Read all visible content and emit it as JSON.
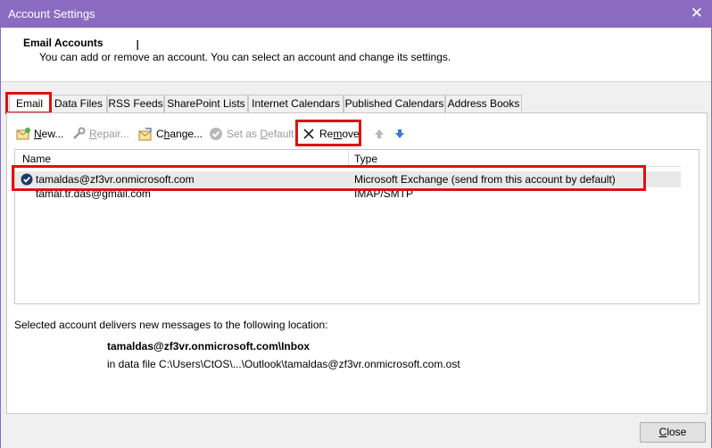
{
  "window": {
    "title": "Account Settings",
    "close_glyph": "✕"
  },
  "header": {
    "title": "Email Accounts",
    "description": "You can add or remove an account. You can select an account and change its settings."
  },
  "tabs": [
    {
      "label": "Email",
      "active": true
    },
    {
      "label": "Data Files"
    },
    {
      "label": "RSS Feeds"
    },
    {
      "label": "SharePoint Lists"
    },
    {
      "label": "Internet Calendars"
    },
    {
      "label": "Published Calendars"
    },
    {
      "label": "Address Books"
    }
  ],
  "toolbar": {
    "new": {
      "u": "N",
      "rest": "ew..."
    },
    "repair": {
      "u": "R",
      "rest": "epair..."
    },
    "change": {
      "pre": "C",
      "u": "h",
      "rest": "ange..."
    },
    "set_default": {
      "pre": "Set as ",
      "u": "D",
      "rest": "efault"
    },
    "remove": {
      "pre": "Re",
      "u": "m",
      "rest": "ove"
    }
  },
  "list": {
    "columns": [
      "Name",
      "Type"
    ],
    "rows": [
      {
        "name": "tamaldas@zf3vr.onmicrosoft.com",
        "type": "Microsoft Exchange (send from this account by default)",
        "default": true
      },
      {
        "name": "tamal.tr.das@gmail.com",
        "type": "IMAP/SMTP",
        "default": false
      }
    ]
  },
  "delivery": {
    "caption": "Selected account delivers new messages to the following location:",
    "location": "tamaldas@zf3vr.onmicrosoft.com\\Inbox",
    "data_file": "in data file C:\\Users\\CtOS\\...\\Outlook\\tamaldas@zf3vr.onmicrosoft.com.ost"
  },
  "footer": {
    "close": {
      "u": "C",
      "rest": "lose"
    }
  },
  "colors": {
    "titlebar": "#8b6bc1",
    "highlight": "#e01010"
  }
}
